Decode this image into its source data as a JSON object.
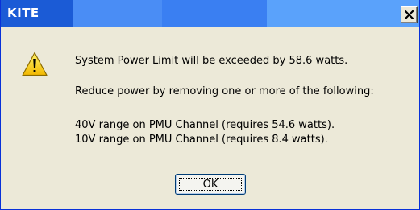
{
  "window": {
    "title": "KITE",
    "close_glyph": "✕",
    "titlebar_color": "#3a7ff2",
    "background_color": "#ece9d8"
  },
  "icon": {
    "name": "warning-icon",
    "glyph": "!",
    "color": "#f5c400"
  },
  "message": {
    "line1": "System Power Limit will be exceeded by 58.6 watts.",
    "line2": "Reduce power by removing one or more of the following:",
    "items": [
      "40V range on PMU Channel (requires 54.6 watts).",
      "10V range on PMU Channel (requires 8.4 watts)."
    ]
  },
  "buttons": {
    "ok_label": "OK"
  }
}
